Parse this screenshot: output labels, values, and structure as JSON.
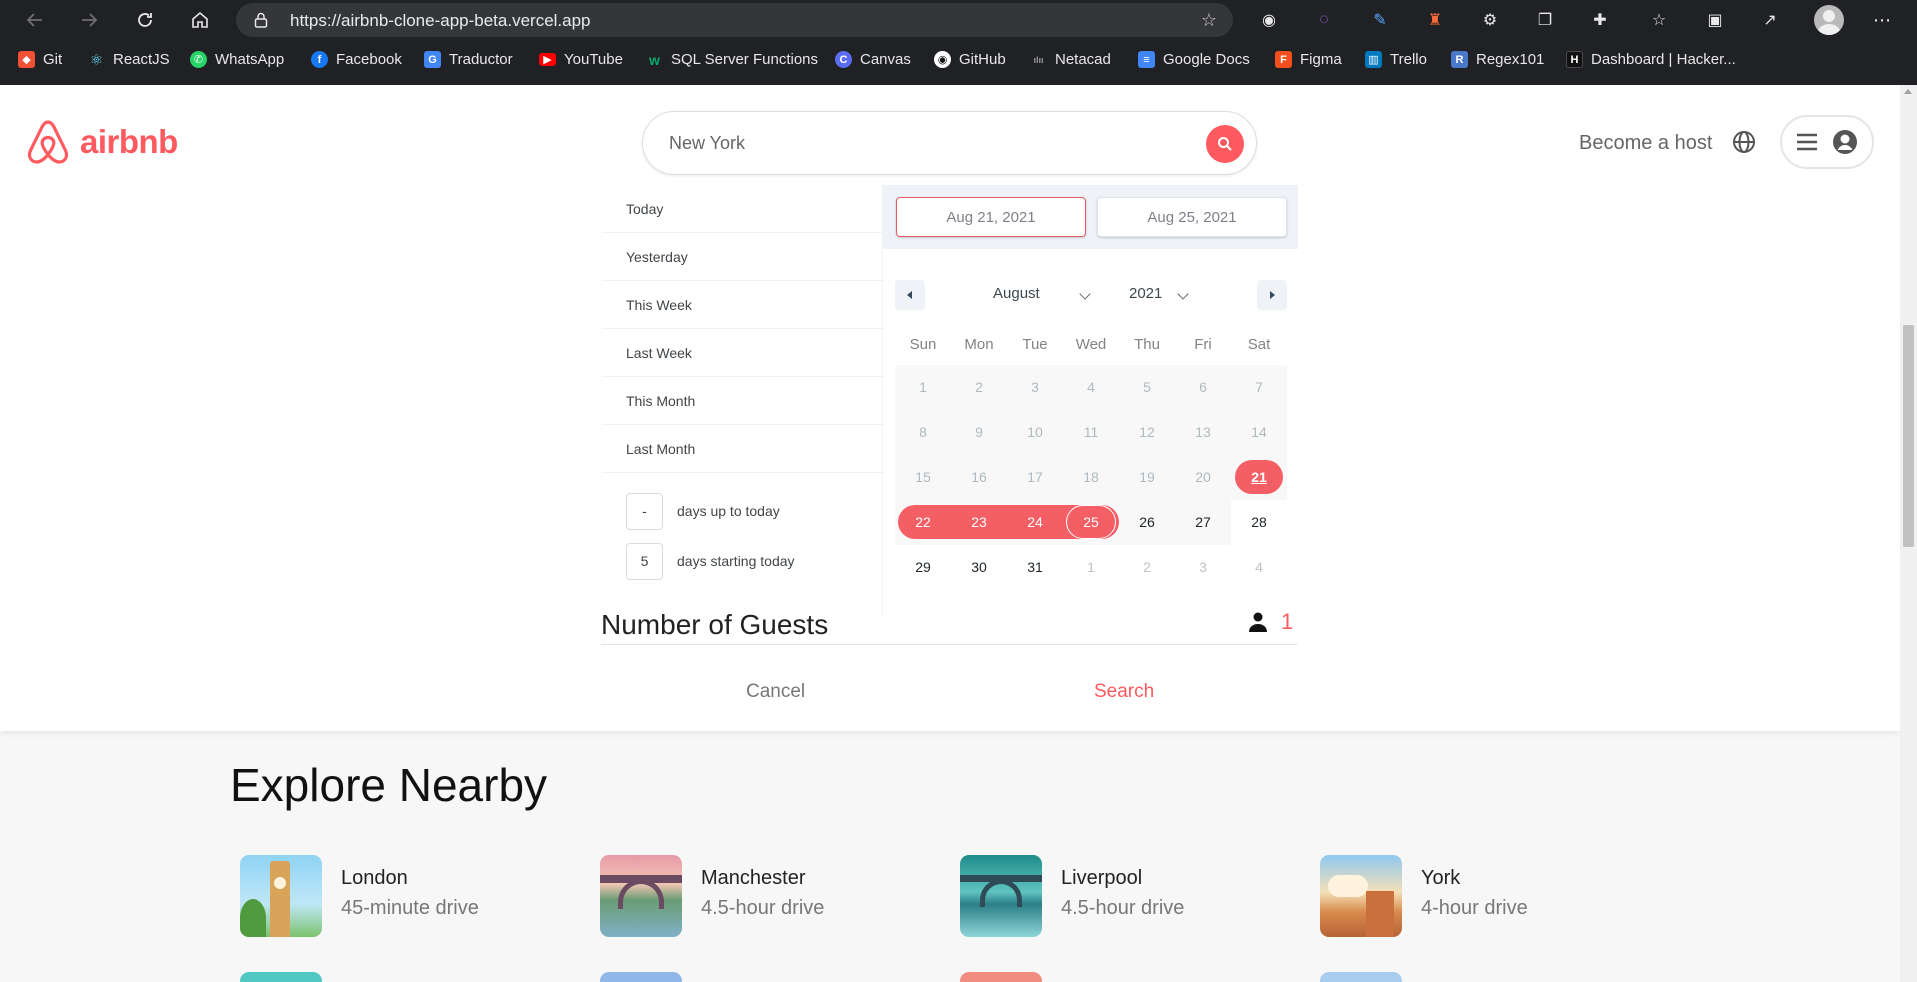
{
  "browser": {
    "url": "https://airbnb-clone-app-beta.vercel.app",
    "bookmarks": [
      {
        "label": "Git",
        "color": "#f05033"
      },
      {
        "label": "ReactJS",
        "color": "#61dafb"
      },
      {
        "label": "WhatsApp",
        "color": "#25d366"
      },
      {
        "label": "Facebook",
        "color": "#1877f2"
      },
      {
        "label": "Traductor",
        "color": "#4285f4"
      },
      {
        "label": "YouTube",
        "color": "#ff0000"
      },
      {
        "label": "SQL Server Functions",
        "color": "#04aa6d"
      },
      {
        "label": "Canvas",
        "color": "#5a6cf0"
      },
      {
        "label": "GitHub",
        "color": "#ffffff"
      },
      {
        "label": "Netacad",
        "color": "#8a8a8a"
      },
      {
        "label": "Google Docs",
        "color": "#4285f4"
      },
      {
        "label": "Figma",
        "color": "#f24e1e"
      },
      {
        "label": "Trello",
        "color": "#0079bf"
      },
      {
        "label": "Regex101",
        "color": "#4a78c8"
      },
      {
        "label": "Dashboard | Hacker...",
        "color": "#1a1a1a"
      }
    ]
  },
  "header": {
    "logo_text": "airbnb",
    "search_value": "New York",
    "become_host": "Become a host"
  },
  "picker": {
    "static_ranges": [
      "Today",
      "Yesterday",
      "This Week",
      "Last Week",
      "This Month",
      "Last Month"
    ],
    "input_ranges": [
      {
        "value": "-",
        "label": "days up to today"
      },
      {
        "value": "5",
        "label": "days starting today"
      }
    ],
    "start_date": "Aug 21, 2021",
    "end_date": "Aug 25, 2021",
    "month": "August",
    "year": "2021",
    "weekdays": [
      "Sun",
      "Mon",
      "Tue",
      "Wed",
      "Thu",
      "Fri",
      "Sat"
    ],
    "weeks": [
      [
        "1",
        "2",
        "3",
        "4",
        "5",
        "6",
        "7"
      ],
      [
        "8",
        "9",
        "10",
        "11",
        "12",
        "13",
        "14"
      ],
      [
        "15",
        "16",
        "17",
        "18",
        "19",
        "20",
        "21"
      ],
      [
        "22",
        "23",
        "24",
        "25",
        "26",
        "27",
        "28"
      ],
      [
        "29",
        "30",
        "31",
        "1",
        "2",
        "3",
        "4"
      ]
    ],
    "selected_start": "21",
    "selected_end": "25"
  },
  "guests": {
    "label": "Number of Guests",
    "count": "1"
  },
  "actions": {
    "cancel": "Cancel",
    "search": "Search"
  },
  "explore": {
    "title": "Explore Nearby",
    "items": [
      {
        "city": "London",
        "distance": "45-minute drive"
      },
      {
        "city": "Manchester",
        "distance": "4.5-hour drive"
      },
      {
        "city": "Liverpool",
        "distance": "4.5-hour drive"
      },
      {
        "city": "York",
        "distance": "4-hour drive"
      }
    ]
  },
  "colors": {
    "brand": "#ff5a5f",
    "range": "#f45e65"
  }
}
